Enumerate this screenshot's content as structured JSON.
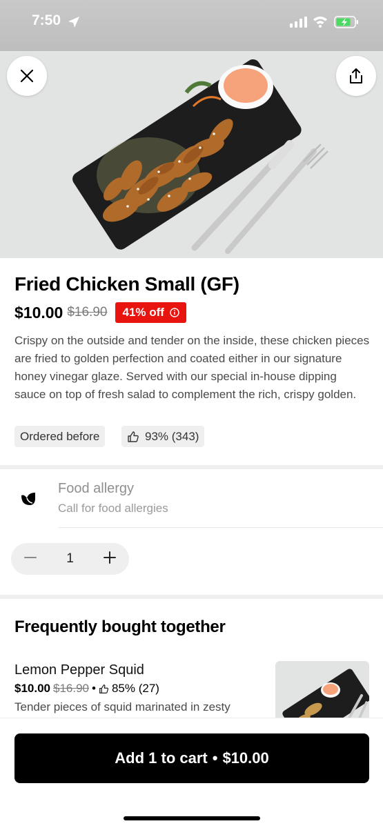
{
  "status_bar": {
    "time": "7:50"
  },
  "item": {
    "title": "Fried Chicken Small (GF)",
    "price": "$10.00",
    "original_price": "$16.90",
    "discount": "41% off",
    "description": "Crispy on the outside and tender on the inside, these chicken pieces are  fried to golden perfection and coated either in our signature honey vinegar glaze. Served with our special in-house dipping sauce  on top of fresh salad to complement the rich, crispy golden.",
    "badges": {
      "ordered_before": "Ordered before",
      "rating": "93% (343)"
    }
  },
  "allergy": {
    "title": "Food allergy",
    "subtitle": "Call for food allergies"
  },
  "quantity": {
    "value": "1"
  },
  "frequently_bought": {
    "title": "Frequently bought together",
    "items": [
      {
        "name": "Lemon Pepper Squid",
        "price": "$10.00",
        "original_price": "$16.90",
        "separator": "•",
        "rating": "85% (27)",
        "description": "Tender pieces of squid marinated in zesty"
      }
    ]
  },
  "cart_button": {
    "label": "Add 1 to cart",
    "separator": "•",
    "price": "$10.00"
  },
  "icons": [
    "location-arrow-icon",
    "signal-icon",
    "wifi-icon",
    "battery-icon",
    "close-icon",
    "share-icon",
    "info-icon",
    "thumbs-up-icon",
    "allergy-icon",
    "minus-icon",
    "plus-icon"
  ],
  "colors": {
    "discount_badge": "#e8140f",
    "cart_button": "#000000",
    "chip_background": "#efefef"
  }
}
